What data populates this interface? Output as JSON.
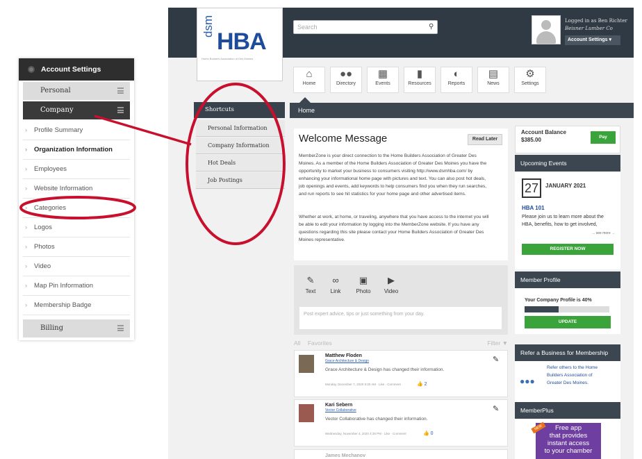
{
  "left_panel": {
    "header": "Account Settings",
    "tab_personal": "Personal",
    "tab_company": "Company",
    "items": [
      "Profile Summary",
      "Organization Information",
      "Employees",
      "Website Information",
      "Categories",
      "Logos",
      "Photos",
      "Video",
      "Map Pin Information",
      "Membership Badge"
    ],
    "tab_billing": "Billing"
  },
  "logo": {
    "dsm": "dsm",
    "hba": "HBA",
    "tagline": "Home Builders Association of Des Moines"
  },
  "header": {
    "search_placeholder": "Search",
    "logged_in": "Logged in as Ben Richter",
    "company": "Beisner Lumber Co",
    "account_button": "Account Settings ▾"
  },
  "nav": [
    "Home",
    "Directory",
    "Events",
    "Resources",
    "Reports",
    "News",
    "Settings"
  ],
  "home_label": "Home",
  "shortcuts": {
    "title": "Shortcuts",
    "items": [
      "Personal Information",
      "Company Information",
      "Hot Deals",
      "Job Postings"
    ]
  },
  "welcome": {
    "title": "Welcome Message",
    "read_later": "Read Later",
    "lines": [
      "MemberZone is your direct connection to the Home Builders Association of Greater Des",
      "Moines.  As a member of the Home Builders Association of Greater Des Moines you have the",
      "opportunity to market your business to consumers visiting http://www.dsmhba.com/ by",
      "enhancing your informational home page with pictures and text.  You can also post hot deals,",
      "job openings and events, add keywords to help consumers find you when they run searches,",
      "and run reports to see hit statistics for your home page and other advertised items.",
      "",
      "Whether at work, at home, or traveling, anywhere that you have access to the internet you will",
      "be able to edit your information by logging into the MemberZone website.  If you have any",
      "questions regarding this site please contact your Home Builders Association of Greater Des",
      "Moines representative."
    ]
  },
  "poster": {
    "tools": [
      "Text",
      "Link",
      "Photo",
      "Video"
    ],
    "placeholder": "Post expert advice, tips or just something from your day."
  },
  "favorites": {
    "all": "All",
    "favorites": "Favorites",
    "filter": "Filter ▼"
  },
  "feed": [
    {
      "name": "Matthew Floden",
      "company": "Grace Architecture & Design",
      "change": "Grace Architecture & Design has changed their information.",
      "timestamp": "Monday, December 7, 2020 8:30 AM · Like · Comment",
      "likes": "2"
    },
    {
      "name": "Kari Sebern",
      "company": "Vector Collaborative",
      "change": "Vector Collaborative has changed their information.",
      "timestamp": "Wednesday, November 4, 2020 4:28 PM · Like · Comment",
      "likes": "0"
    },
    {
      "name": "James Mechanov"
    }
  ],
  "account_balance": {
    "label": "Account Balance",
    "amount": "$385.00",
    "pay": "Pay"
  },
  "events": {
    "title": "Upcoming Events",
    "day": "27",
    "month": "JANUARY 2021",
    "name": "HBA 101",
    "desc1": "Please join us to learn more about the",
    "desc2": "HBA, benefits, how to get involved,",
    "see_more": "... see more →",
    "register": "REGISTER NOW"
  },
  "member_profile": {
    "title": "Member Profile",
    "text": "Your Company Profile is 40%",
    "progress": 0.4,
    "update": "UPDATE"
  },
  "refer": {
    "title": "Refer a Business for Membership",
    "lines": [
      "Refer others to the Home",
      "Builders Association of",
      "Greater Des Moines."
    ]
  },
  "memberplus": {
    "title": "MemberPlus",
    "badge": "NEW",
    "lines": [
      "Free app",
      "that provides",
      "instant access",
      "to your chamber"
    ]
  },
  "colors": {
    "accent_red": "#c8102e",
    "dark_bar": "#2f3a44",
    "green": "#3aa33a",
    "brand_blue": "#1e4c9a"
  }
}
